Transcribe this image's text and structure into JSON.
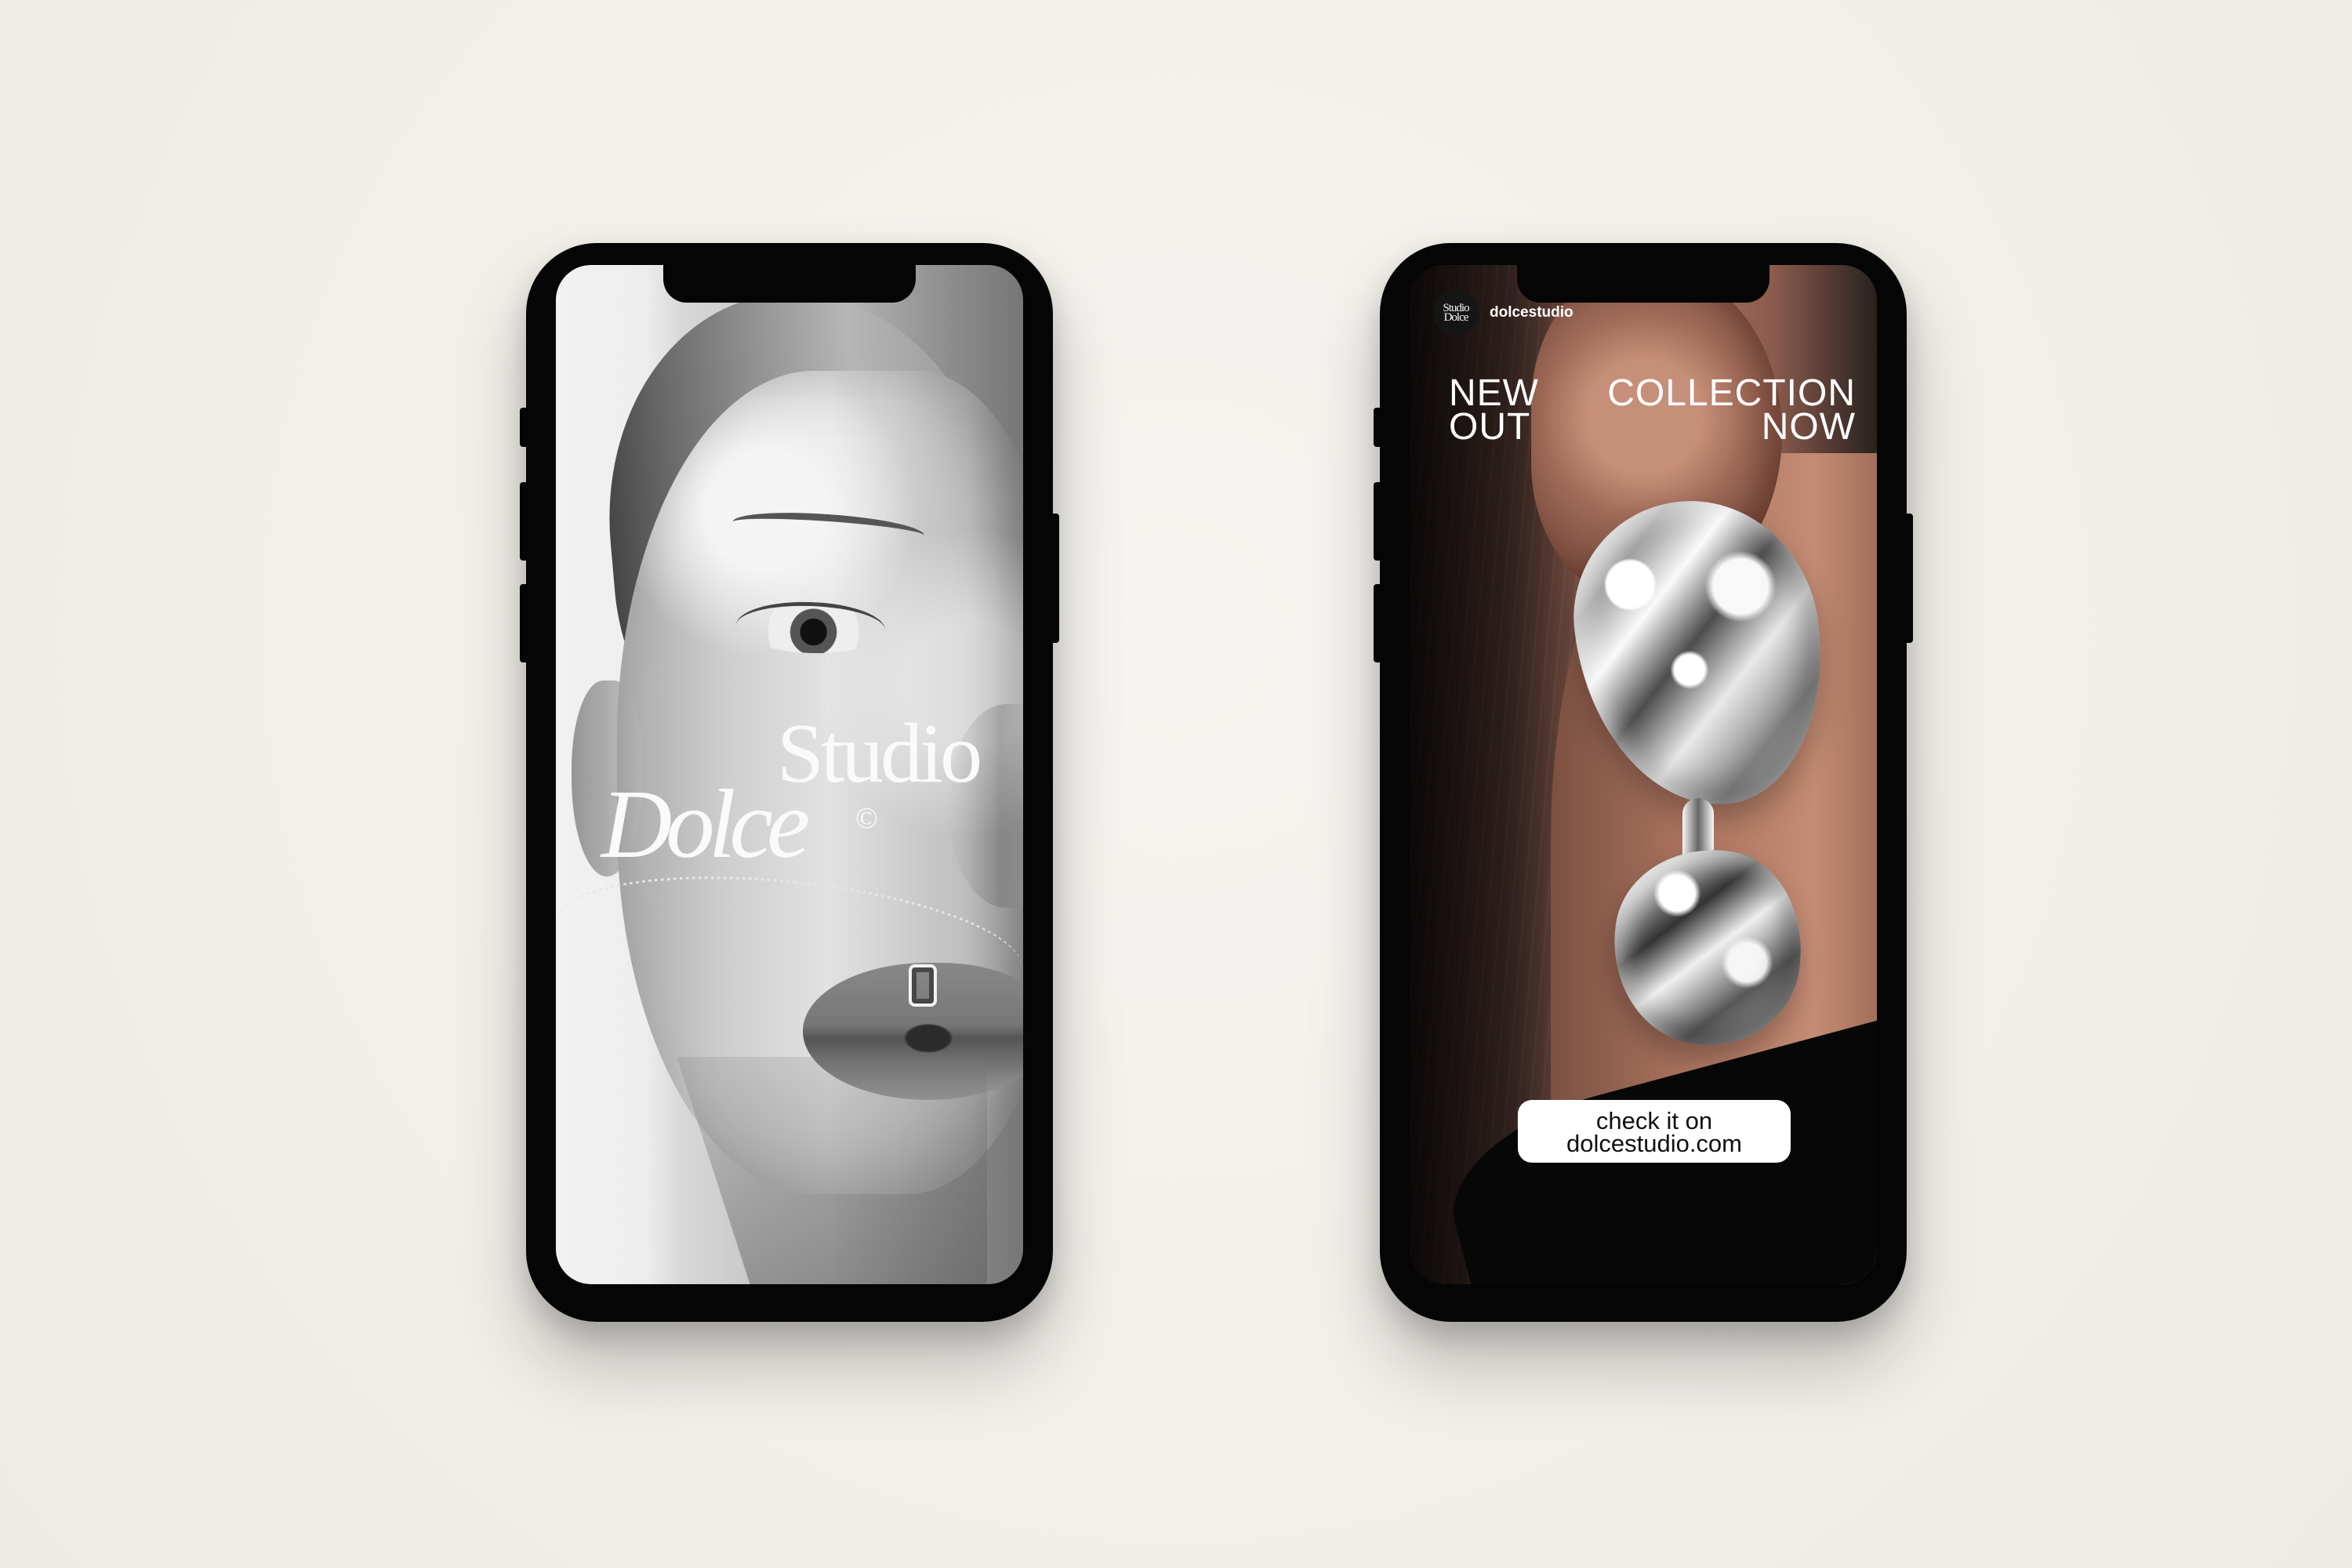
{
  "left_phone": {
    "brand_studio": "Studio",
    "brand_dolce": "Dolce",
    "copyright_symbol": "©"
  },
  "right_phone": {
    "avatar_text": "Studio Dolce",
    "handle": "dolcestudio",
    "headline_left": "NEW\nOUT",
    "headline_right": "COLLECTION\nNOW",
    "cta": "check it on\ndolcestudio.com"
  },
  "colors": {
    "background": "#f3f1ed",
    "phone_frame": "#050505",
    "text_white": "#ffffff",
    "cta_background": "#ffffff"
  }
}
